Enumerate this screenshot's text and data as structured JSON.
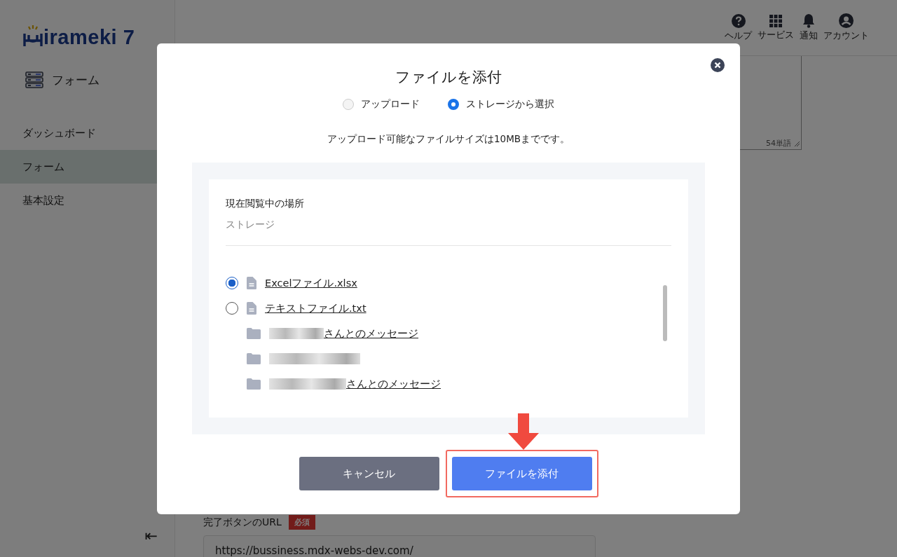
{
  "logo": {
    "text": "irameki 7"
  },
  "sidebar": {
    "section": "フォーム",
    "items": [
      {
        "label": "ダッシュボード",
        "selected": false
      },
      {
        "label": "フォーム",
        "selected": true
      },
      {
        "label": "基本設定",
        "selected": false
      }
    ],
    "collapse": "⇤"
  },
  "header": {
    "actions": [
      {
        "kind": "help",
        "label": "ヘルプ"
      },
      {
        "kind": "services",
        "label": "サービス"
      },
      {
        "kind": "notify",
        "label": "通知"
      },
      {
        "kind": "account",
        "label": "アカウント"
      }
    ]
  },
  "editor": {
    "word_count": "54単語"
  },
  "form_field": {
    "label": "完了ボタンのURL",
    "badge": "必須",
    "value": "https://bussiness.mdx-webs-dev.com/"
  },
  "dialog": {
    "title": "ファイルを添付",
    "sources": [
      {
        "label": "アップロード",
        "selected": false
      },
      {
        "label": "ストレージから選択",
        "selected": true
      }
    ],
    "note": "アップロード可能なファイルサイズは10MBまでです。",
    "location_label": "現在閲覧中の場所",
    "location": "ストレージ",
    "entries": [
      {
        "kind": "file",
        "name": "Excelファイル.xlsx",
        "selected": true
      },
      {
        "kind": "file",
        "name": "テキストファイル.txt",
        "selected": false
      },
      {
        "kind": "folder",
        "name": "さんとのメッセージ",
        "redacted": true
      },
      {
        "kind": "folder",
        "redacted": true
      },
      {
        "kind": "folder",
        "name": "さんとのメッセージ",
        "redacted": true
      }
    ],
    "buttons": [
      {
        "kind": "cancel",
        "label": "キャンセル"
      },
      {
        "kind": "primary",
        "label": "ファイルを添付",
        "highlighted": true
      }
    ]
  }
}
